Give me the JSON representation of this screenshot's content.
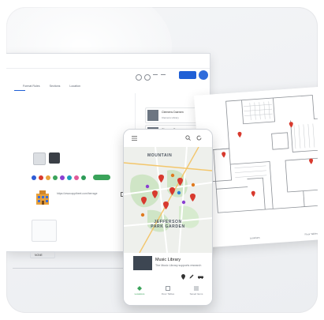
{
  "colors": {
    "accent_blue": "#1f5fd6",
    "accent_orange": "#f0a640",
    "pin_red": "#d83a2e",
    "green_action": "#3aa35a",
    "swatches": [
      "#2e5bd6",
      "#d83a2e",
      "#e8a33d",
      "#3aa35a",
      "#8a3fd1",
      "#1aa0b8",
      "#e05a9a",
      "#2d9b57"
    ]
  },
  "laptop": {
    "tabs": [
      "",
      "Format Rules",
      "Sections",
      "Location"
    ],
    "field_hint": "",
    "url": "https://www.apptheet.com/herrage",
    "select_value": "NONE",
    "cards": [
      {
        "title": "Clemens Daenen",
        "subtitle": "Clemens Library"
      },
      {
        "title": "Clemens Daenen",
        "subtitle": ""
      }
    ]
  },
  "phone": {
    "map_label_top": "MOUNTAIN",
    "map_label_mid": "JEFFERSON PARK GARDEN",
    "place_title": "Music Library",
    "place_subtitle": "The Music Library supports research",
    "nav": [
      "Locations",
      "Floor Tables",
      "Saved Items"
    ]
  },
  "plan": {
    "footer": [
      "Locations",
      "Floor Tables"
    ]
  }
}
